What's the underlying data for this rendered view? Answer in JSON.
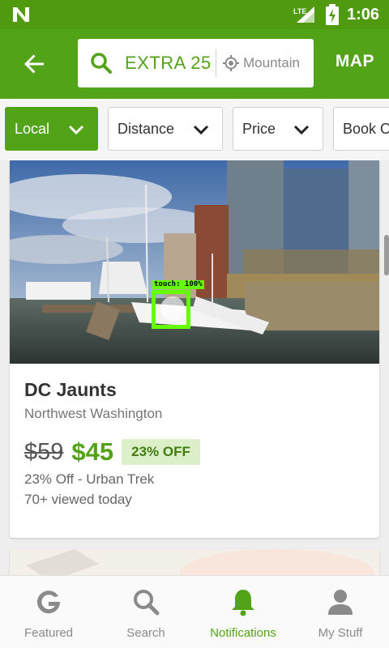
{
  "status_bar": {
    "network": "LTE",
    "time": "1:06"
  },
  "app_bar": {
    "search_query": "EXTRA 25",
    "location": "Mountain",
    "map_label": "MAP"
  },
  "filters": [
    {
      "label": "Local",
      "active": true
    },
    {
      "label": "Distance",
      "active": false
    },
    {
      "label": "Price",
      "active": false
    },
    {
      "label": "Book O",
      "active": false
    }
  ],
  "deal": {
    "title": "DC Jaunts",
    "location": "Northwest Washington",
    "original_price": "$59",
    "sale_price": "$45",
    "discount_badge": "23% OFF",
    "deal_note": "23% Off - Urban Trek",
    "views": "70+ viewed today"
  },
  "touch_overlay": {
    "label": "touch: 100%"
  },
  "bottom_nav": [
    {
      "label": "Featured",
      "icon": "g-logo-icon",
      "active": false
    },
    {
      "label": "Search",
      "icon": "search-icon",
      "active": false
    },
    {
      "label": "Notifications",
      "icon": "bell-icon",
      "active": true
    },
    {
      "label": "My Stuff",
      "icon": "person-icon",
      "active": false
    }
  ],
  "colors": {
    "brand_green": "#53a318",
    "status_bar_green": "#4f9a0f",
    "discount_bg": "#dcefc8",
    "touch_indicator": "#66ff00"
  }
}
